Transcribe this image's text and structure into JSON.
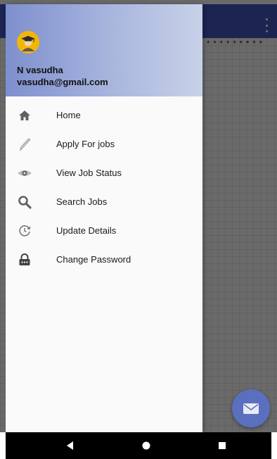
{
  "app": {
    "background_stars": "* * * * * * * * *",
    "colors": {
      "primary": "#3f51b5",
      "accent": "#5b6fbf",
      "drawer_header_start": "#7e8fce",
      "drawer_header_end": "#c7d1e8"
    }
  },
  "drawer": {
    "header": {
      "avatar_icon": "graduate-avatar-icon",
      "user_name": "N vasudha",
      "user_email": "vasudha@gmail.com"
    },
    "menu_items": [
      {
        "label": "Home",
        "icon": "home-icon"
      },
      {
        "label": "Apply For jobs",
        "icon": "pencil-icon"
      },
      {
        "label": "View Job Status",
        "icon": "eye-icon"
      },
      {
        "label": "Search Jobs",
        "icon": "search-icon"
      },
      {
        "label": "Update Details",
        "icon": "history-icon"
      },
      {
        "label": "Change Password",
        "icon": "lock-icon"
      }
    ]
  },
  "fab": {
    "icon": "envelope-icon"
  },
  "navbar": {
    "back_icon": "back-triangle-icon",
    "home_icon": "home-circle-icon",
    "recents_icon": "recents-square-icon"
  }
}
